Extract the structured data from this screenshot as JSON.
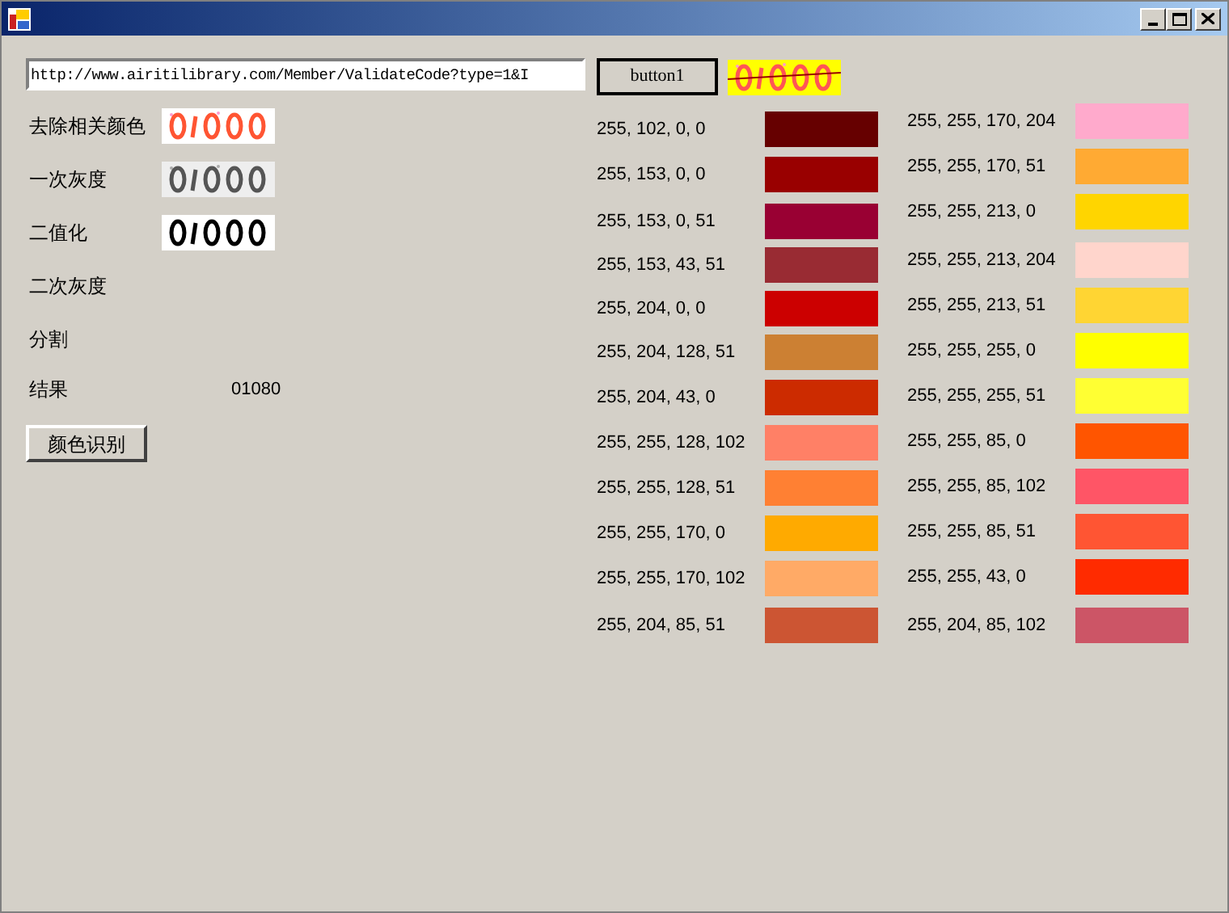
{
  "url_field": {
    "value": "http://www.airitilibrary.com/Member/ValidateCode?type=1&I"
  },
  "fetch_button": "button1",
  "steps": [
    {
      "label": "去除相关颜色",
      "kind": "colored"
    },
    {
      "label": "一次灰度",
      "kind": "gray"
    },
    {
      "label": "二值化",
      "kind": "binary"
    },
    {
      "label": "二次灰度",
      "kind": "text"
    },
    {
      "label": "分割",
      "kind": "text"
    }
  ],
  "result": {
    "label": "结果",
    "value": "01080"
  },
  "recognize_button": "颜色识别",
  "swatch_columns": [
    [
      {
        "label": "255, 102, 0, 0",
        "color": "#660000"
      },
      {
        "label": "255, 153, 0, 0",
        "color": "#990000"
      },
      {
        "label": "255, 153, 0, 51",
        "color": "#990033"
      },
      {
        "label": "255, 153, 43, 51",
        "color": "#992b33"
      },
      {
        "label": "255, 204, 0, 0",
        "color": "#cc0000"
      },
      {
        "label": "255, 204, 128, 51",
        "color": "#cc8033"
      },
      {
        "label": "255, 204, 43, 0",
        "color": "#cc2b00"
      },
      {
        "label": "255, 255, 128, 102",
        "color": "#ff8066"
      },
      {
        "label": "255, 255, 128, 51",
        "color": "#ff8033"
      },
      {
        "label": "255, 255, 170, 0",
        "color": "#ffaa00"
      },
      {
        "label": "255, 255, 170, 102",
        "color": "#ffaa66"
      },
      {
        "label": "255, 204, 85, 51",
        "color": "#cc5533"
      }
    ],
    [
      {
        "label": "255, 255, 170, 204",
        "color": "#ffaacc"
      },
      {
        "label": "255, 255, 170, 51",
        "color": "#ffaa33"
      },
      {
        "label": "255, 255, 213, 0",
        "color": "#ffd500"
      },
      {
        "label": "255, 255, 213, 204",
        "color": "#ffd5cc"
      },
      {
        "label": "255, 255, 213, 51",
        "color": "#ffd533"
      },
      {
        "label": "255, 255, 255, 0",
        "color": "#ffff00"
      },
      {
        "label": "255, 255, 255, 51",
        "color": "#ffff33"
      },
      {
        "label": "255, 255, 85, 0",
        "color": "#ff5500"
      },
      {
        "label": "255, 255, 85, 102",
        "color": "#ff5566"
      },
      {
        "label": "255, 255, 85, 51",
        "color": "#ff5533"
      },
      {
        "label": "255, 255, 43, 0",
        "color": "#ff2b00"
      },
      {
        "label": "255, 204, 85, 102",
        "color": "#cc5566"
      }
    ]
  ]
}
